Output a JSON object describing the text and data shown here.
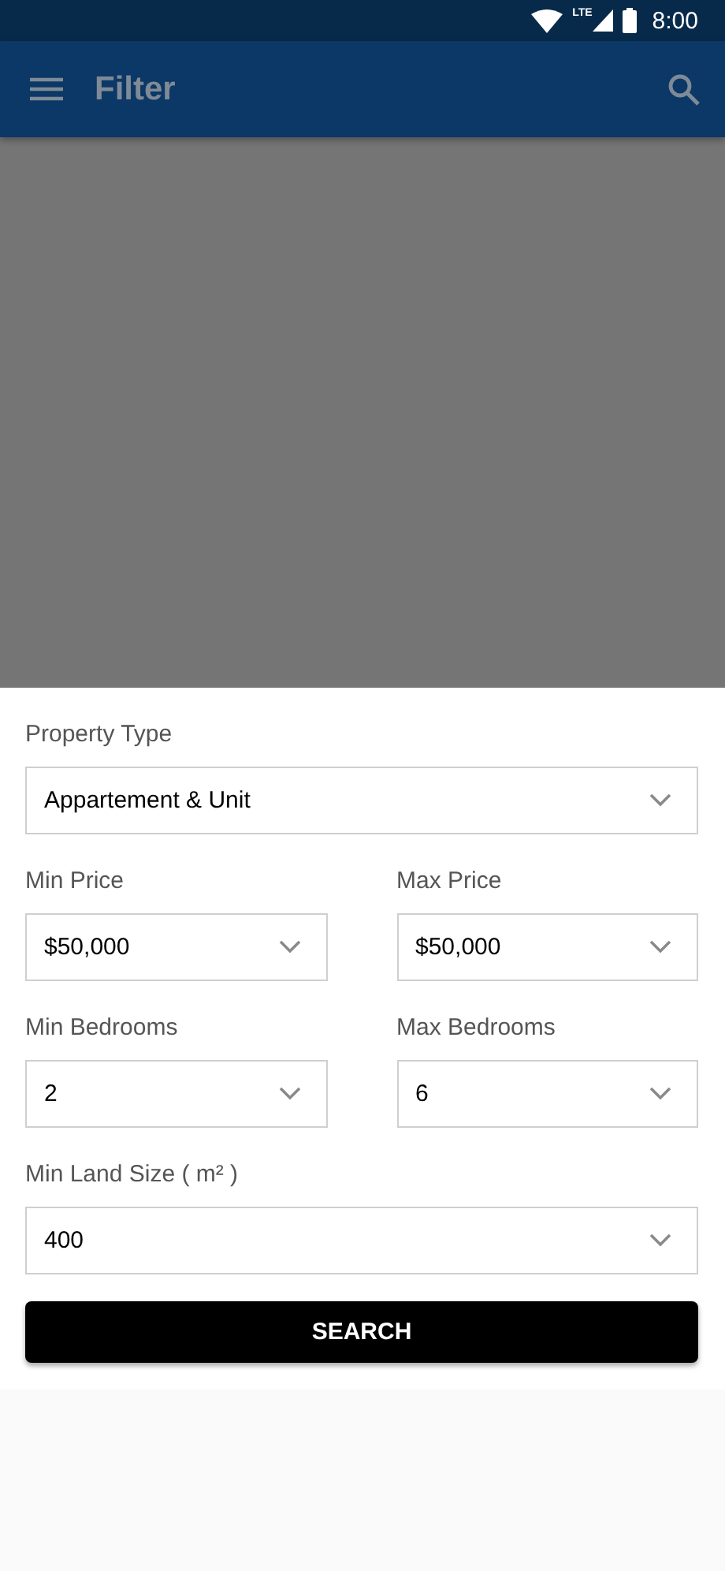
{
  "status_bar": {
    "network": "LTE",
    "time": "8:00"
  },
  "app_bar": {
    "title": "Filter"
  },
  "form": {
    "rows": [
      {
        "fields": [
          {
            "label": "Property Type",
            "value": "Appartement & Unit"
          }
        ]
      },
      {
        "fields": [
          {
            "label": "Min Price",
            "value": "$50,000"
          },
          {
            "label": "Max Price",
            "value": "$50,000"
          }
        ]
      },
      {
        "fields": [
          {
            "label": "Min Bedrooms",
            "value": "2"
          },
          {
            "label": "Max Bedrooms",
            "value": "6"
          }
        ]
      },
      {
        "fields": [
          {
            "label": "Min Land Size ( m² )",
            "value": "400"
          }
        ]
      }
    ],
    "button": "SEARCH"
  }
}
